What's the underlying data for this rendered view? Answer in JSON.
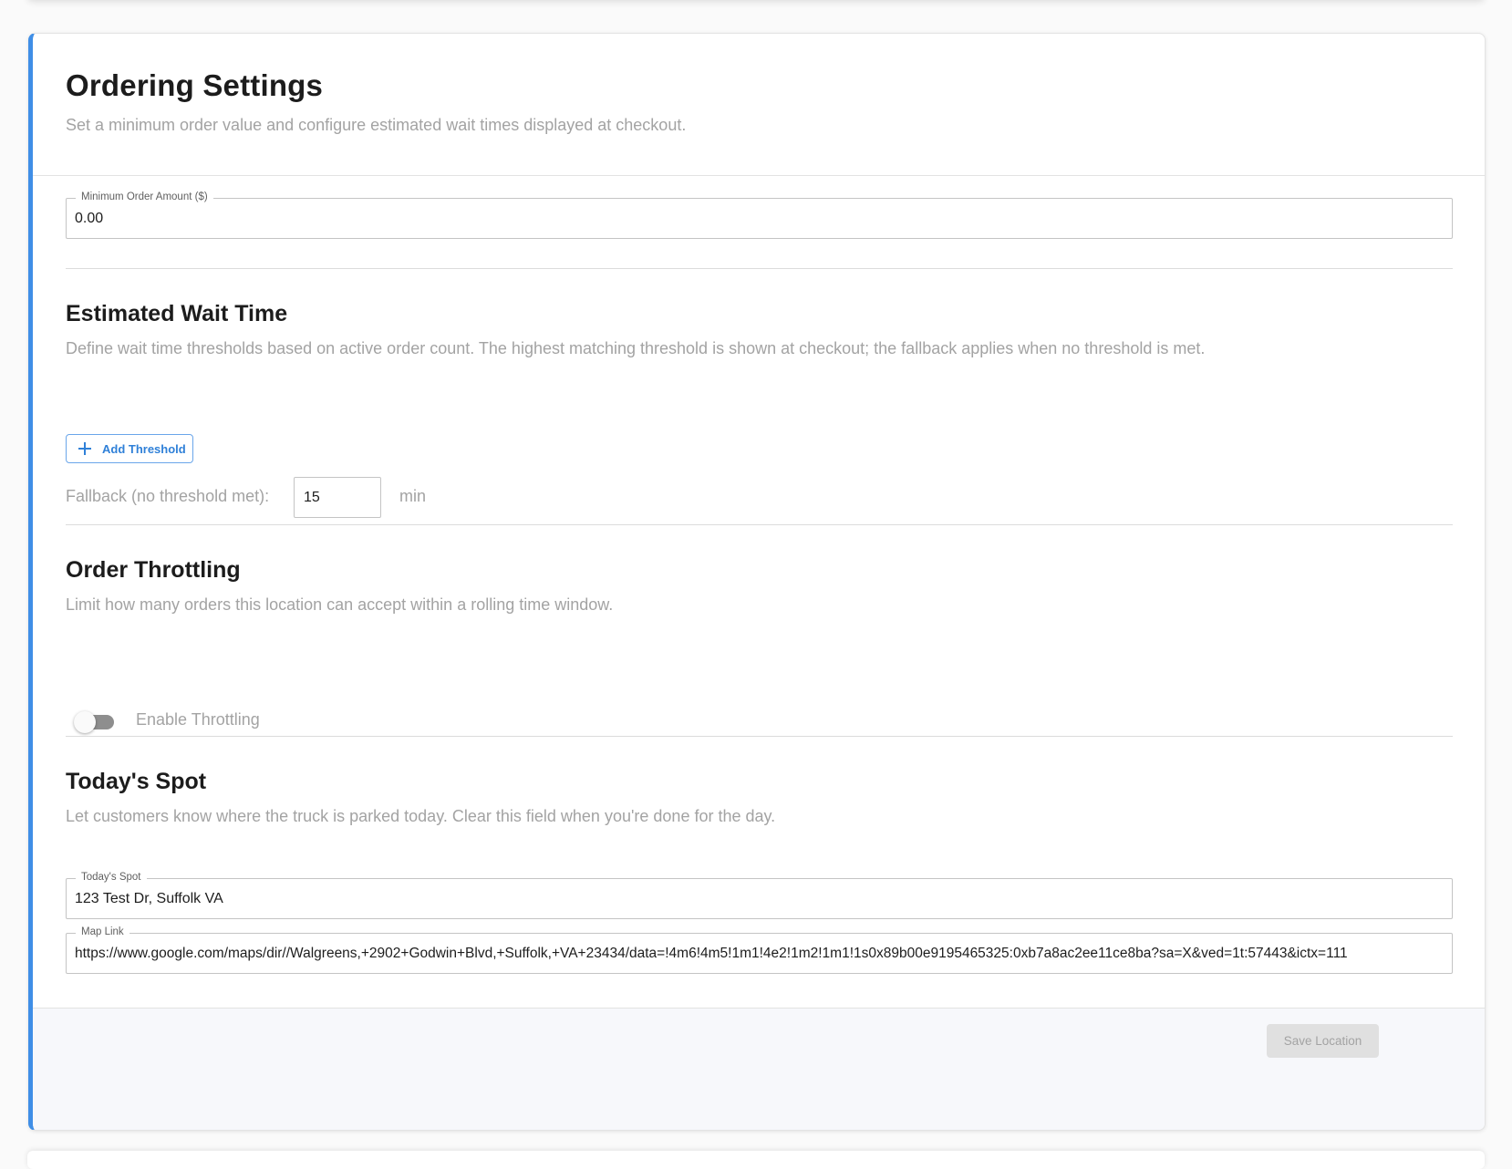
{
  "header": {
    "title": "Ordering Settings",
    "subtitle": "Set a minimum order value and configure estimated wait times displayed at checkout."
  },
  "minimum_order": {
    "label": "Minimum Order Amount ($)",
    "value": "0.00"
  },
  "wait_time": {
    "title": "Estimated Wait Time",
    "description": "Define wait time thresholds based on active order count. The highest matching threshold is shown at checkout; the fallback applies when no threshold is met.",
    "add_threshold_label": "Add Threshold",
    "fallback_label": "Fallback (no threshold met):",
    "fallback_value": "15",
    "fallback_unit": "min"
  },
  "throttling": {
    "title": "Order Throttling",
    "description": "Limit how many orders this location can accept within a rolling time window.",
    "toggle_label": "Enable Throttling",
    "enabled": false
  },
  "todays_spot": {
    "title": "Today's Spot",
    "description": "Let customers know where the truck is parked today. Clear this field when you're done for the day.",
    "spot_label": "Today's Spot",
    "spot_value": "123 Test Dr, Suffolk VA",
    "map_label": "Map Link",
    "map_value": "https://www.google.com/maps/dir//Walgreens,+2902+Godwin+Blvd,+Suffolk,+VA+23434/data=!4m6!4m5!1m1!4e2!1m2!1m1!1s0x89b00e9195465325:0xb7a8ac2ee11ce8ba?sa=X&ved=1t:57443&ictx=111"
  },
  "footer": {
    "save_label": "Save Location"
  },
  "colors": {
    "accent": "#3f8ee6",
    "link_blue": "#2f80d8",
    "muted_text": "#a3a3a3",
    "disabled_button": "#e0e0e0"
  }
}
